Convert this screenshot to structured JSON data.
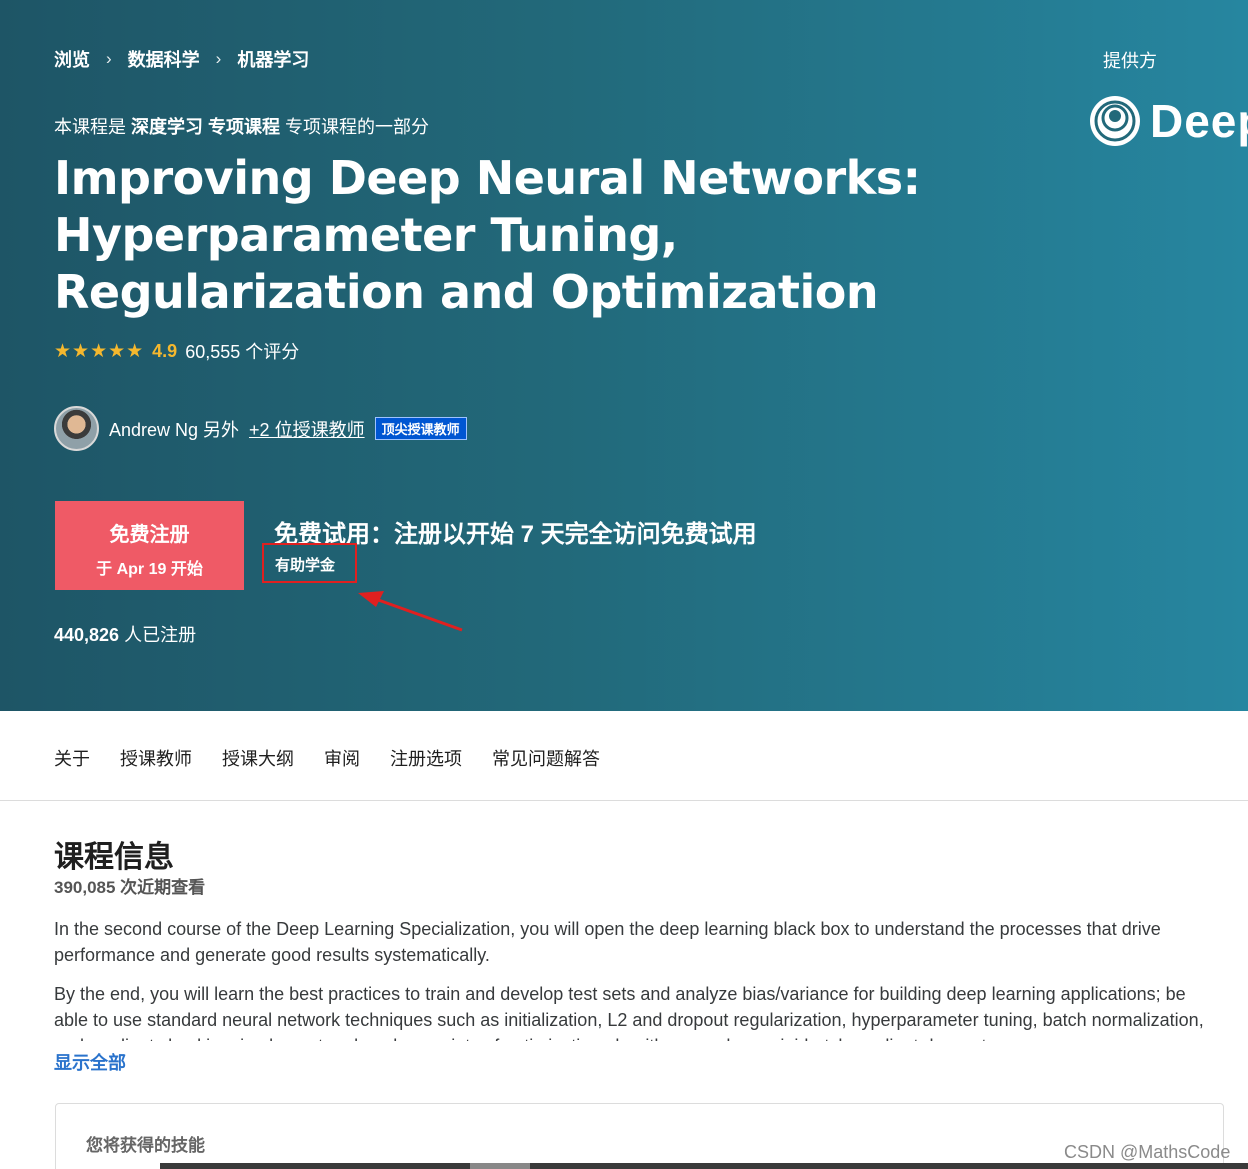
{
  "breadcrumb": {
    "items": [
      "浏览",
      "数据科学",
      "机器学习"
    ],
    "separator": "›"
  },
  "provider": {
    "label": "提供方",
    "logo_text": "Deep"
  },
  "part_of": {
    "prefix": "本课程是",
    "specialization": "深度学习 专项课程",
    "suffix": "专项课程的一部分"
  },
  "course": {
    "title": "Improving Deep Neural Networks: Hyperparameter Tuning, Regularization and Optimization",
    "stars": "★★★★★",
    "rating": "4.9",
    "rating_count": "60,555 个评分"
  },
  "instructor": {
    "name": "Andrew Ng 另外",
    "more_link": "+2 位授课教师",
    "badge": "顶尖授课教师"
  },
  "enroll": {
    "button_main": "免费注册",
    "button_sub": "于 Apr 19 开始",
    "trial_text": "免费试用：注册以开始 7 天完全访问免费试用",
    "financial_aid": "有助学金",
    "enrolled_count": "440,826",
    "enrolled_suffix": "人已注册"
  },
  "tabs": [
    "关于",
    "授课教师",
    "授课大纲",
    "审阅",
    "注册选项",
    "常见问题解答"
  ],
  "about": {
    "heading": "课程信息",
    "views": "390,085 次近期查看",
    "paragraph1": "In the second course of the Deep Learning Specialization, you will open the deep learning black box to understand the processes that drive performance and generate good results systematically.",
    "paragraph2": "By the end, you will learn the best practices to train and develop test sets and analyze bias/variance for building deep learning applications; be able to use standard neural network techniques such as initialization, L2 and dropout regularization, hyperparameter tuning, batch normalization, and gradient checking; implement and apply a variety of optimization algorithms, such as mini-batch gradient descent,",
    "show_all": "显示全部",
    "skills_heading": "您将获得的技能"
  },
  "watermark": "CSDN @MathsCode",
  "colors": {
    "hero_start": "#1e5566",
    "hero_end": "#2686a0",
    "enroll_button": "#ef5a66",
    "star": "#f5b82e",
    "highlight_box": "#e02020",
    "link_blue": "#2a73cc"
  }
}
